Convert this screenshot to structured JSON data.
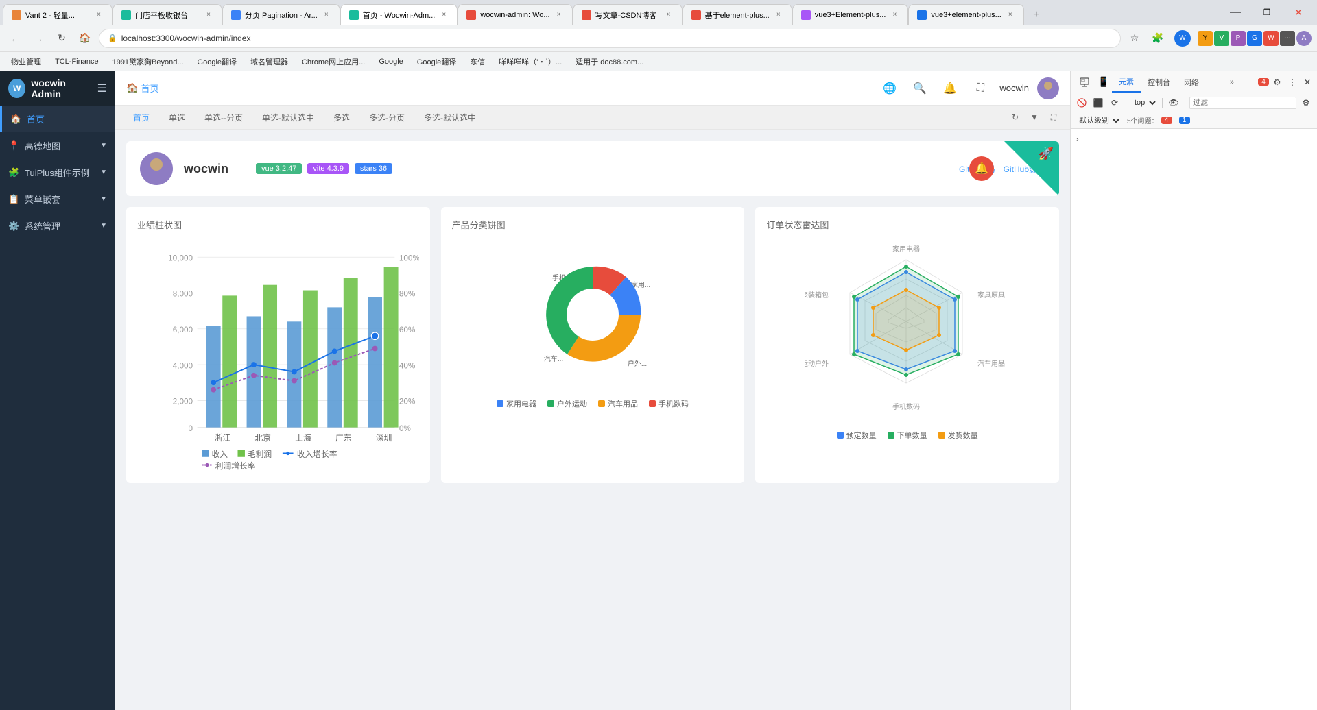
{
  "browser": {
    "tabs": [
      {
        "id": 1,
        "label": "Vant 2 - 轻量...",
        "favicon_color": "#e8843a",
        "active": false
      },
      {
        "id": 2,
        "label": "门店平板收银台",
        "favicon_color": "#1abc9c",
        "active": false
      },
      {
        "id": 3,
        "label": "分页 Pagination - Ar...",
        "favicon_color": "#3b82f6",
        "active": false
      },
      {
        "id": 4,
        "label": "首页 - Wocwin-Adm...",
        "favicon_color": "#1abc9c",
        "active": true
      },
      {
        "id": 5,
        "label": "wocwin-admin: Wo...",
        "favicon_color": "#e74c3c",
        "active": false
      },
      {
        "id": 6,
        "label": "写文章-CSDN博客",
        "favicon_color": "#e74c3c",
        "active": false
      },
      {
        "id": 7,
        "label": "基于element-plus...",
        "favicon_color": "#e74c3c",
        "active": false
      },
      {
        "id": 8,
        "label": "vue3+Element-plus...",
        "favicon_color": "#a855f7",
        "active": false
      },
      {
        "id": 9,
        "label": "vue3+element-plus...",
        "favicon_color": "#1a73e8",
        "active": false
      }
    ],
    "url": "localhost:3300/wocwin-admin/index",
    "bookmarks": [
      "物业管理",
      "TCL-Finance",
      "1991黛家狗Beyond...",
      "Google翻译",
      "域名管理器",
      "Chrome网上应用...",
      "Google",
      "Google翻译",
      "东信",
      "咩咩咩咩（'・`）...",
      "适用于 doc88.com..."
    ]
  },
  "sidebar": {
    "title": "wocwin Admin",
    "menu_icon": "☰",
    "items": [
      {
        "label": "首页",
        "icon": "🏠",
        "active": true,
        "hasArrow": false
      },
      {
        "label": "高德地图",
        "icon": "📍",
        "active": false,
        "hasArrow": true
      },
      {
        "label": "TuiPlus组件示例",
        "icon": "🧩",
        "active": false,
        "hasArrow": true
      },
      {
        "label": "菜单嵌套",
        "icon": "📋",
        "active": false,
        "hasArrow": true
      },
      {
        "label": "系统管理",
        "icon": "⚙️",
        "active": false,
        "hasArrow": true
      }
    ]
  },
  "header": {
    "breadcrumb": "首页",
    "home_icon": "🏠",
    "username": "wocwin",
    "icons": {
      "translate": "🌐",
      "search": "🔍",
      "bell": "🔔",
      "fullscreen": "⛶"
    }
  },
  "page_tabs": {
    "tabs": [
      {
        "label": "首页",
        "active": true
      },
      {
        "label": "单选",
        "active": false
      },
      {
        "label": "单选--分页",
        "active": false
      },
      {
        "label": "单选-默认选中",
        "active": false
      },
      {
        "label": "多选",
        "active": false
      },
      {
        "label": "多选-分页",
        "active": false
      },
      {
        "label": "多选-默认选中",
        "active": false
      }
    ],
    "btn_refresh": "↻",
    "btn_down": "▼",
    "btn_fullscreen": "⛶"
  },
  "user_card": {
    "name": "wocwin",
    "badge_vue": "vue  3.2.47",
    "badge_vite": "vite  4.3.9",
    "badge_stars": "stars  36",
    "link_gitee": "Gitee源码",
    "link_github": "GitHub源码",
    "notification_icon": "🔔"
  },
  "charts": {
    "bar_chart": {
      "title": "业绩柱状图",
      "y_labels": [
        "10,000",
        "8,000",
        "6,000",
        "4,000",
        "2,000",
        "0"
      ],
      "y_right_labels": [
        "100%",
        "80%",
        "60%",
        "40%",
        "20%",
        "0%"
      ],
      "x_labels": [
        "浙江",
        "北京",
        "上海",
        "广东",
        "深圳"
      ],
      "legend": [
        "收入",
        "毛利润",
        "收入增长率",
        "利润增长率"
      ],
      "data_blue": [
        5500,
        6200,
        5800,
        6800,
        7200
      ],
      "data_green": [
        7200,
        7800,
        7500,
        8200,
        8800
      ],
      "data_line1": [
        30,
        45,
        38,
        55,
        65
      ],
      "data_line2": [
        25,
        35,
        30,
        45,
        55
      ]
    },
    "donut_chart": {
      "title": "产品分类饼图",
      "segments": [
        {
          "label": "手机...",
          "value": 20,
          "color": "#e74c3c",
          "start_angle": 0
        },
        {
          "label": "家用...",
          "value": 25,
          "color": "#3b82f6",
          "start_angle": 72
        },
        {
          "label": "汽车...",
          "value": 30,
          "color": "#f39c12",
          "start_angle": 162
        },
        {
          "label": "户外...",
          "value": 25,
          "color": "#27ae60",
          "start_angle": 270
        }
      ],
      "legend": [
        {
          "label": "家用电器",
          "color": "#3b82f6"
        },
        {
          "label": "户外运动",
          "color": "#27ae60"
        },
        {
          "label": "汽车用品",
          "color": "#f39c12"
        },
        {
          "label": "手机数码",
          "color": "#e74c3c"
        }
      ]
    },
    "radar_chart": {
      "title": "订单状态雷达图",
      "axes": [
        "家用电器",
        "家具原具",
        "汽车用品",
        "手机数码",
        "运动户外",
        "聚装箱包"
      ],
      "series": [
        {
          "label": "预定数量",
          "color": "#3b82f6",
          "values": [
            0.8,
            0.7,
            0.6,
            0.5,
            0.7,
            0.6
          ]
        },
        {
          "label": "下单数量",
          "color": "#27ae60",
          "values": [
            0.9,
            0.85,
            0.75,
            0.65,
            0.8,
            0.7
          ]
        },
        {
          "label": "发货数量",
          "color": "#f39c12",
          "values": [
            0.5,
            0.45,
            0.55,
            0.6,
            0.5,
            0.4
          ]
        }
      ]
    }
  },
  "devtools": {
    "tabs": [
      "元素",
      "控制台",
      "网络"
    ],
    "more_label": "»",
    "badge_red": "4",
    "toolbar_buttons": [
      "🚫",
      "⬛",
      "⟳",
      "🔍",
      "⬜"
    ],
    "filter_placeholder": "过滤",
    "select_top": "top",
    "select_level": "默认级别",
    "problems_label": "5个问题：",
    "badge_4": "4",
    "badge_1": "1",
    "settings_icon": "⚙",
    "close_icon": "✕",
    "arrow_label": "›"
  }
}
